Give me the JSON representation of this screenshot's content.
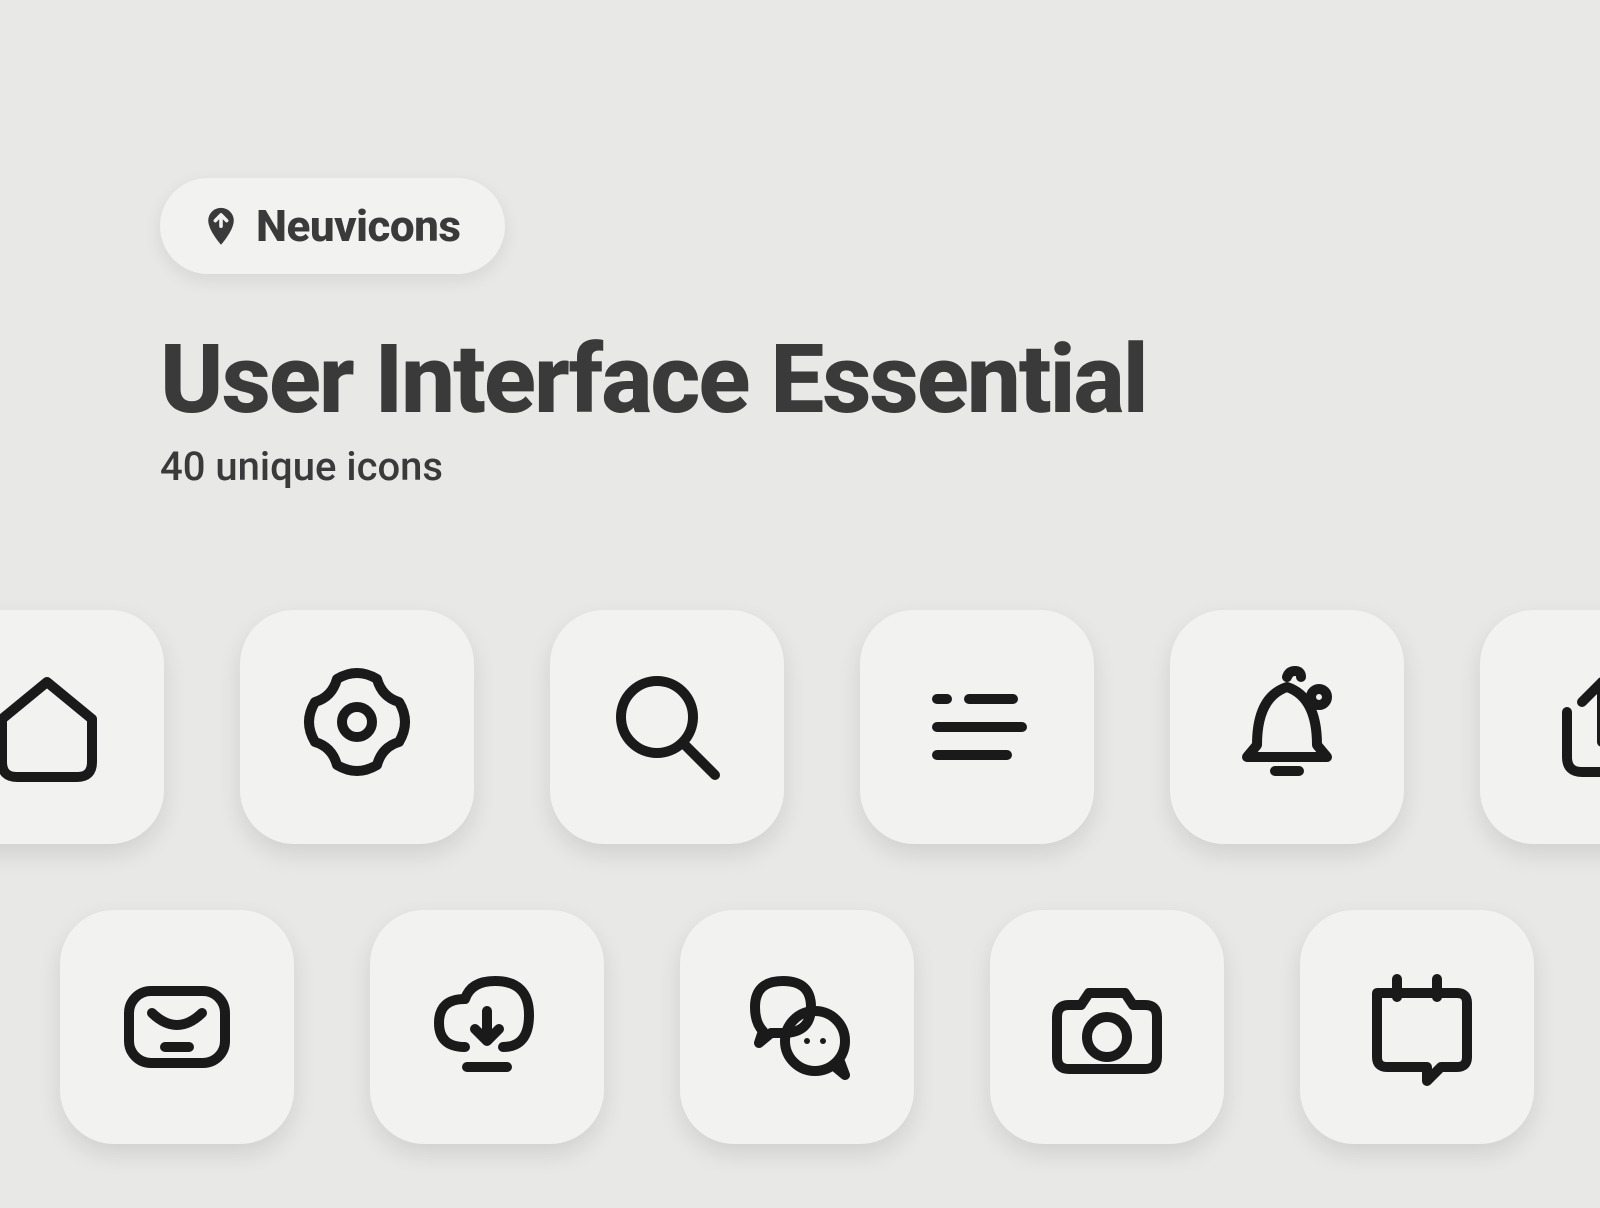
{
  "brand": {
    "name": "Neuvicons",
    "logo_icon": "map-pin-icon"
  },
  "title": "User Interface Essential",
  "subtitle": "40 unique icons",
  "icons_row1": [
    {
      "name": "home-icon"
    },
    {
      "name": "settings-icon"
    },
    {
      "name": "search-icon"
    },
    {
      "name": "menu-icon"
    },
    {
      "name": "bell-icon"
    },
    {
      "name": "share-icon"
    }
  ],
  "icons_row2": [
    {
      "name": "mail-icon"
    },
    {
      "name": "cloud-download-icon"
    },
    {
      "name": "chat-icon"
    },
    {
      "name": "camera-icon"
    },
    {
      "name": "notes-icon"
    }
  ]
}
